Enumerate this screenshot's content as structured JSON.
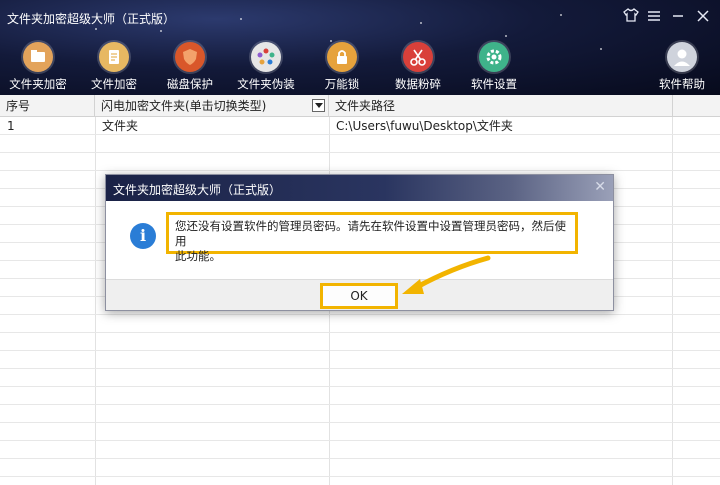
{
  "window": {
    "title": "文件夹加密超级大师（正式版）",
    "controls": [
      "shirt-icon",
      "menu-icon",
      "minimize-icon",
      "close-icon"
    ]
  },
  "toolbar": {
    "items": [
      {
        "label": "文件夹加密",
        "icon": "folder-icon",
        "color": "#e3a35b"
      },
      {
        "label": "文件加密",
        "icon": "clipboard-icon",
        "color": "#e7b862"
      },
      {
        "label": "磁盘保护",
        "icon": "shield-icon",
        "color": "#d9572a"
      },
      {
        "label": "文件夹伪装",
        "icon": "palette-icon",
        "color": "#e6e6e6"
      },
      {
        "label": "万能锁",
        "icon": "lock-icon",
        "color": "#e6a23c"
      },
      {
        "label": "数据粉碎",
        "icon": "scissors-icon",
        "color": "#d9403a"
      },
      {
        "label": "软件设置",
        "icon": "gear-icon",
        "color": "#3fb38a"
      },
      {
        "label": "软件帮助",
        "icon": "user-icon",
        "color": "#cfd3dc"
      }
    ]
  },
  "table": {
    "headers": [
      "序号",
      "闪电加密文件夹(单击切换类型)",
      "文件夹路径"
    ],
    "rows": [
      {
        "index": "1",
        "name": "文件夹",
        "path": "C:\\Users\\fuwu\\Desktop\\文件夹"
      }
    ]
  },
  "dialog": {
    "title": "文件夹加密超级大师（正式版）",
    "icon": "info-icon",
    "message_line1": "您还没有设置软件的管理员密码。请先在软件设置中设置管理员密码，然后使用",
    "message_line2": "此功能。",
    "ok_label": "OK",
    "highlight_color": "#f2b400"
  }
}
